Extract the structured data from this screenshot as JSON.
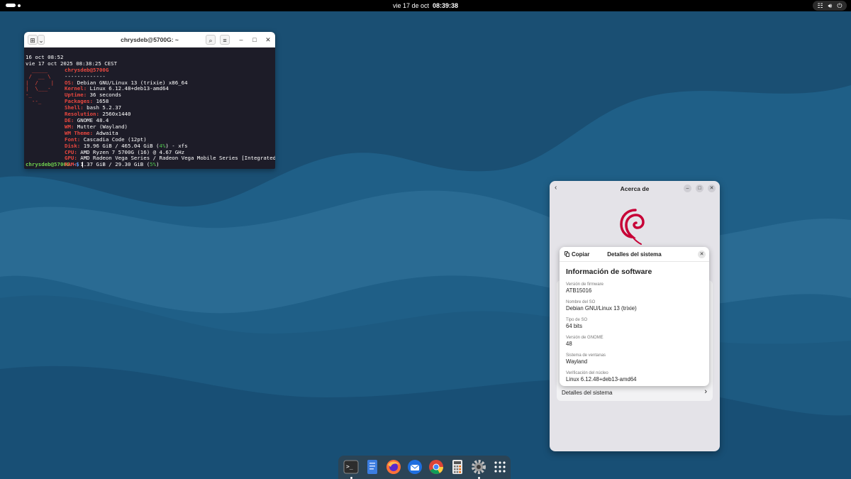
{
  "topbar": {
    "date": "vie 17 de oct",
    "time": "08:39:38",
    "tray_icons": [
      "network-icon",
      "volume-icon",
      "power-icon"
    ]
  },
  "terminal": {
    "title": "chrysdeb@5700G: ~",
    "lines_top": [
      "16 oct 08:52",
      "vie 17 oct 2025 08:38:25 CEST"
    ],
    "user_host": "chrysdeb@5700G",
    "separator": "-------------",
    "info": [
      {
        "key": "OS:",
        "value": " Debian GNU/Linux 13 (trixie) x86_64"
      },
      {
        "key": "Kernel:",
        "value": " Linux 6.12.48+deb13-amd64"
      },
      {
        "key": "Uptime:",
        "value": " 36 seconds"
      },
      {
        "key": "Packages:",
        "value": " 1658"
      },
      {
        "key": "Shell:",
        "value": " bash 5.2.37"
      },
      {
        "key": "Resolution:",
        "value": " 2560x1440"
      },
      {
        "key": "DE:",
        "value": " GNOME 48.4"
      },
      {
        "key": "WM:",
        "value": " Mutter (Wayland)"
      },
      {
        "key": "WM Theme:",
        "value": " Adwaita"
      },
      {
        "key": "Font:",
        "value": " Cascadia Code (12pt)"
      },
      {
        "key": "Disk:",
        "value": " 19.96 GiB / 465.04 GiB (",
        "pct": "4%",
        "tail": ") - xfs"
      },
      {
        "key": "CPU:",
        "value": " AMD Ryzen 7 5700G (16) @ 4.67 GHz"
      },
      {
        "key": "GPU:",
        "value": " AMD Radeon Vega Series / Radeon Vega Mobile Series [Integrated]"
      },
      {
        "key": "RAM:",
        "value": " 1.37 GiB / 29.30 GiB (",
        "pct": "5%",
        "tail": ")"
      }
    ],
    "prompt_user": "chrysdeb@5700G",
    "prompt_path": ":~$ "
  },
  "about": {
    "title": "Acerca de",
    "system_details_row": "Detalles del sistema"
  },
  "dialog": {
    "copy_label": "Copiar",
    "title": "Detalles del sistema",
    "section_title": "Información de software",
    "fields": [
      {
        "label": "Versión de firmware",
        "value": "ATB15016"
      },
      {
        "label": "Nombre del SO",
        "value": "Debian GNU/Linux 13 (trixie)"
      },
      {
        "label": "Tipo de SO",
        "value": "64 bits"
      },
      {
        "label": "Versión de GNOME",
        "value": "48"
      },
      {
        "label": "Sistema de ventanas",
        "value": "Wayland"
      },
      {
        "label": "Verificación del núcleo",
        "value": "Linux 6.12.48+deb13-amd64"
      }
    ]
  },
  "dock": {
    "items": [
      "terminal-icon",
      "text-editor-icon",
      "firefox-icon",
      "thunderbird-icon",
      "chrome-icon",
      "calculator-icon",
      "settings-icon",
      "app-grid-icon"
    ]
  },
  "colors": {
    "wallpaper_dark": "#184b6f",
    "wallpaper_light": "#2d6f97",
    "terminal_bg": "#1d1c28",
    "terminal_key": "#e9473f",
    "debian_red": "#c70036"
  }
}
